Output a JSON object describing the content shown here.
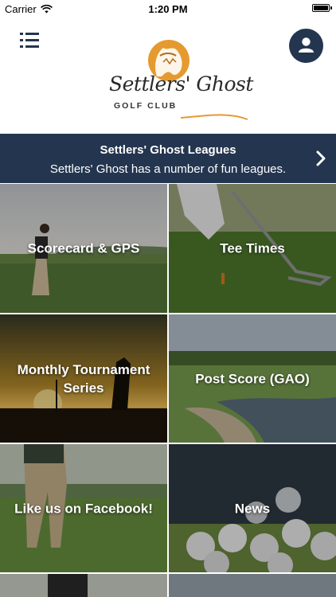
{
  "status_bar": {
    "carrier": "Carrier",
    "time": "1:20 PM"
  },
  "header": {
    "logo": {
      "name": "Settlers' Ghost",
      "subtitle": "GOLF CLUB"
    },
    "icons": {
      "menu": "menu-list-icon",
      "profile": "user-icon"
    }
  },
  "banner": {
    "title": "Settlers' Ghost Leagues",
    "subtitle": "Settlers' Ghost has a number of fun leagues."
  },
  "tiles": [
    {
      "label": "Scorecard & GPS"
    },
    {
      "label": "Tee Times"
    },
    {
      "label": "Monthly Tournament Series"
    },
    {
      "label": "Post Score (GAO)"
    },
    {
      "label": "Like us on Facebook!"
    },
    {
      "label": "News"
    }
  ],
  "colors": {
    "navy": "#24354f",
    "logo_orange": "#e59a2f"
  }
}
